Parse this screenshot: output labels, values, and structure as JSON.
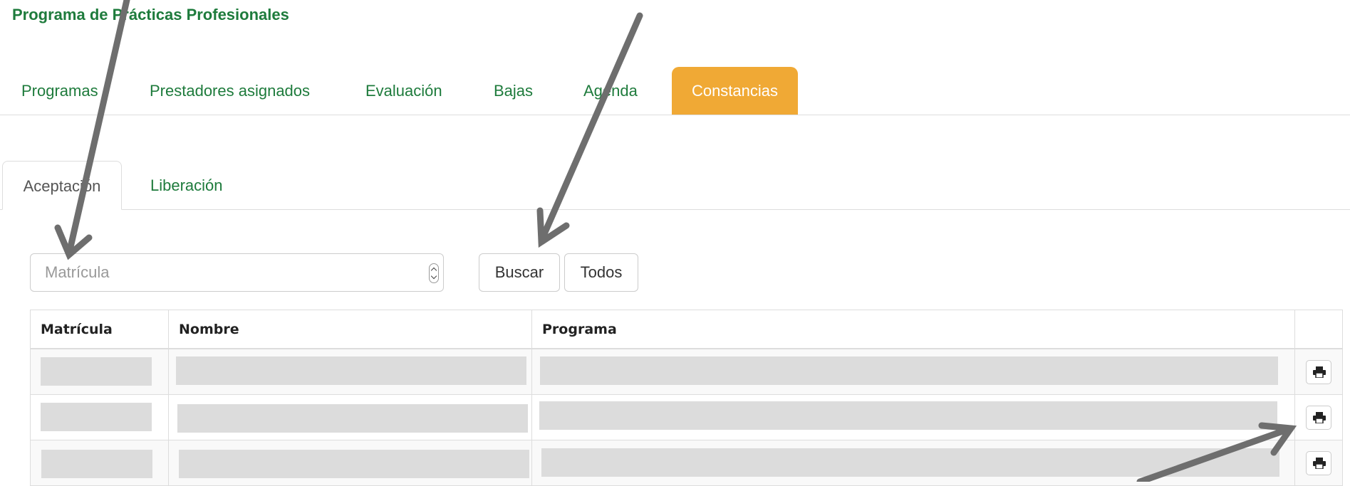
{
  "header": {
    "title": "Programa de Prácticas Profesionales"
  },
  "main_tabs": [
    {
      "label": "Programas",
      "active": false
    },
    {
      "label": "Prestadores asignados",
      "active": false
    },
    {
      "label": "Evaluación",
      "active": false
    },
    {
      "label": "Bajas",
      "active": false
    },
    {
      "label": "Agenda",
      "active": false
    },
    {
      "label": "Constancias",
      "active": true
    }
  ],
  "sub_tabs": [
    {
      "label": "Aceptación",
      "active": true
    },
    {
      "label": "Liberación",
      "active": false
    }
  ],
  "search": {
    "placeholder": "Matrícula",
    "value": ""
  },
  "buttons": {
    "search_label": "Buscar",
    "all_label": "Todos"
  },
  "table": {
    "columns": [
      "Matrícula",
      "Nombre",
      "Programa",
      ""
    ],
    "rows": [
      {
        "matricula": "",
        "nombre": "",
        "programa": "",
        "action_icon": "print-icon"
      },
      {
        "matricula": "",
        "nombre": "",
        "programa": "",
        "action_icon": "print-icon"
      },
      {
        "matricula": "",
        "nombre": "",
        "programa": "",
        "action_icon": "print-icon"
      }
    ]
  },
  "colors": {
    "brand_green": "#1e7b3c",
    "active_tab_orange": "#f0a935",
    "annotation_arrow": "#6e6e6e",
    "redaction_gray": "#dcdcdc"
  }
}
